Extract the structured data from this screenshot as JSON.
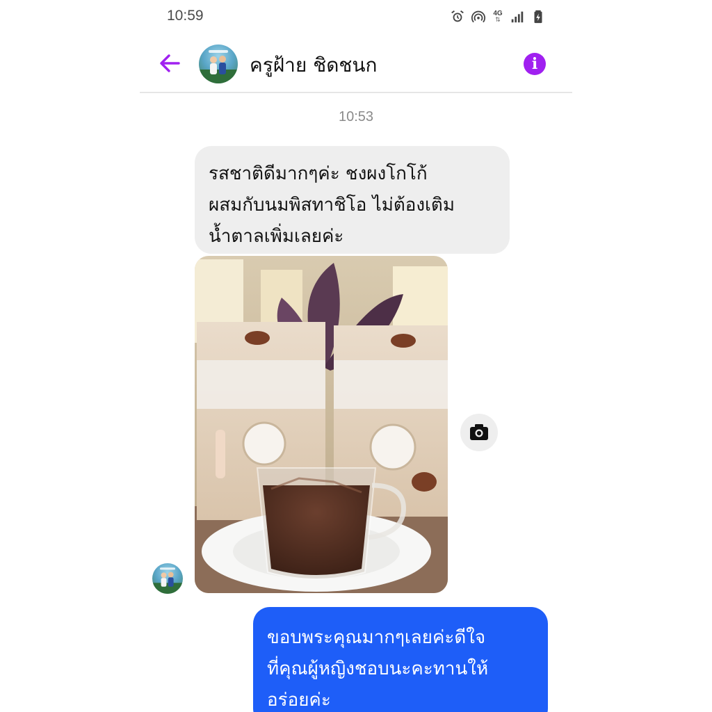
{
  "status_bar": {
    "time": "10:59",
    "network": "4G",
    "icons": [
      "alarm-icon",
      "hotspot-icon",
      "signal-icon",
      "battery-charging-icon"
    ]
  },
  "header": {
    "contact_name": "ครูฝ้าย ชิดชนก",
    "back_icon": "arrow-left-icon",
    "info_icon": "info-icon",
    "info_glyph": "i",
    "accent_color": "#a020f0"
  },
  "conversation": {
    "timestamp": "10:53",
    "incoming_message": "รสชาติดีมากๆค่ะ ชงผงโกโก้\nผสมกับนมพิสทาชิโอ ไม่ต้องเติม\nน้ำตาลเพิ่มเลยค่ะ",
    "incoming_bubble_color": "#eeeeee",
    "photo_icon_action": "camera-icon",
    "outgoing_message": "ขอบพระคุณมากๆเลยค่ะดีใจ\nที่คุณผู้หญิงชอบนะคะทานให้\nอร่อยค่ะ",
    "outgoing_bubble_color": "#1e5ef8"
  }
}
